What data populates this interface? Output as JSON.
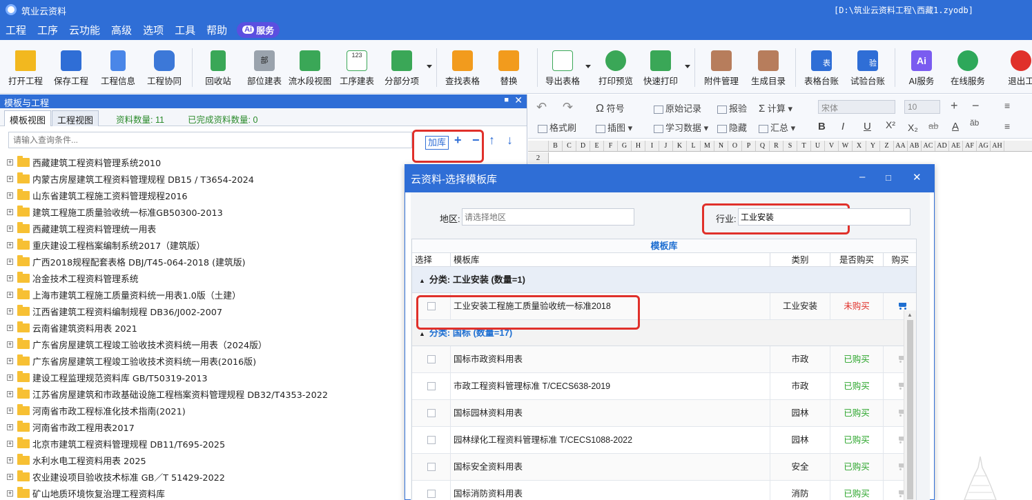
{
  "window": {
    "app_title": "筑业云资料",
    "file_path": "[D:\\筑业云资料工程\\西藏1.zyodb]"
  },
  "menu": [
    "工程",
    "工序",
    "云功能",
    "高级",
    "选项",
    "工具",
    "帮助"
  ],
  "ai_service": {
    "mark": "Ai",
    "label": "服务"
  },
  "ribbon": {
    "open": "打开工程",
    "save": "保存工程",
    "info": "工程信息",
    "collab": "工程协同",
    "recycle": "回收站",
    "part": "部位建表",
    "flow": "流水段视图",
    "process": "工序建表",
    "subitem": "分部分项",
    "find": "查找表格",
    "replace": "替换",
    "export": "导出表格",
    "preview": "打印预览",
    "quickprint": "快速打印",
    "attach": "附件管理",
    "catalog": "生成目录",
    "ledger": "表格台账",
    "testledger": "试验台账",
    "ai": "AI服务",
    "online": "在线服务",
    "exit": "退出工"
  },
  "ribbon_icon_text": {
    "part": "部",
    "process": "123",
    "ledger": "表",
    "testledger": "验",
    "ai": "Ai"
  },
  "left_panel": {
    "title": "模板与工程",
    "tab_template": "模板视图",
    "tab_project": "工程视图",
    "data_count": "资料数量: 11",
    "done_count": "已完成资料数量: 0",
    "search_placeholder": "请输入查询条件...",
    "add_lib": "加库"
  },
  "tree": [
    "西藏建筑工程资料管理系统2010",
    "内蒙古房屋建筑工程资料管理规程 DB15 / T3654-2024",
    "山东省建筑工程施工资料管理规程2016",
    "建筑工程施工质量验收统一标准GB50300-2013",
    "西藏建筑工程资料管理统一用表",
    "重庆建设工程档案编制系统2017（建筑版）",
    "广西2018规程配套表格 DBJ/T45-064-2018 (建筑版)",
    "冶金技术工程资料管理系统",
    "上海市建筑工程施工质量资料统一用表1.0版（土建）",
    "江西省建筑工程资料编制规程 DB36/J002-2007",
    "云南省建筑资料用表 2021",
    "广东省房屋建筑工程竣工验收技术资料统一用表（2024版）",
    "广东省房屋建筑工程竣工验收技术资料统一用表(2016版)",
    "建设工程监理规范资料库 GB/T50319-2013",
    "江苏省房屋建筑和市政基础设施工程档案资料管理规程 DB32/T4353-2022",
    "河南省市政工程标准化技术指南(2021)",
    "河南省市政工程用表2017",
    "北京市建筑工程资料管理规程 DB11/T695-2025",
    "水利水电工程资料用表 2025",
    "农业建设项目验收技术标准 GB／T 51429-2022",
    "矿山地质环境恢复治理工程资料库"
  ],
  "format_toolbar": {
    "fmt_painter": "格式刷",
    "symbol": "符号",
    "insert_pic": "插图",
    "original": "原始记录",
    "learn_data": "学习数据",
    "inspect": "报验",
    "hide": "隐藏",
    "calc": "计算",
    "summary": "汇总",
    "font": "宋体",
    "size": "10"
  },
  "sheet": {
    "columns": [
      "B",
      "C",
      "D",
      "E",
      "F",
      "G",
      "H",
      "I",
      "J",
      "K",
      "L",
      "M",
      "N",
      "O",
      "P",
      "Q",
      "R",
      "S",
      "T",
      "U",
      "V",
      "W",
      "X",
      "Y",
      "Z",
      "AA",
      "AB",
      "AC",
      "AD",
      "AE",
      "AF",
      "AG",
      "AH"
    ],
    "row": "2"
  },
  "dialog": {
    "title": "云资料-选择模板库",
    "region_label": "地区:",
    "region_placeholder": "请选择地区",
    "industry_label": "行业:",
    "industry_value": "工业安装",
    "grid_title": "模板库",
    "headers": {
      "select": "选择",
      "lib": "模板库",
      "type": "类别",
      "bought": "是否购买",
      "buy": "购买"
    },
    "groups": [
      {
        "label": "分类: 工业安装 (数量=1)",
        "rows": [
          {
            "name": "工业安装工程施工质量验收统一标准2018",
            "type": "工业安装",
            "status": "未购买"
          }
        ]
      },
      {
        "label": "分类: 国标 (数量=17)",
        "rows": [
          {
            "name": "国标市政资料用表",
            "type": "市政",
            "status": "已购买"
          },
          {
            "name": "市政工程资料管理标准 T/CECS638-2019",
            "type": "市政",
            "status": "已购买"
          },
          {
            "name": "国标园林资料用表",
            "type": "园林",
            "status": "已购买"
          },
          {
            "name": "园林绿化工程资料管理标准 T/CECS1088-2022",
            "type": "园林",
            "status": "已购买"
          },
          {
            "name": "国标安全资料用表",
            "type": "安全",
            "status": "已购买"
          },
          {
            "name": "国标消防资料用表",
            "type": "消防",
            "status": "已购买"
          }
        ]
      }
    ]
  },
  "colors": {
    "primary": "#2f6ed6",
    "highlight": "#e0302a",
    "bought": "#2aa52a",
    "not_bought": "#e0302a"
  }
}
